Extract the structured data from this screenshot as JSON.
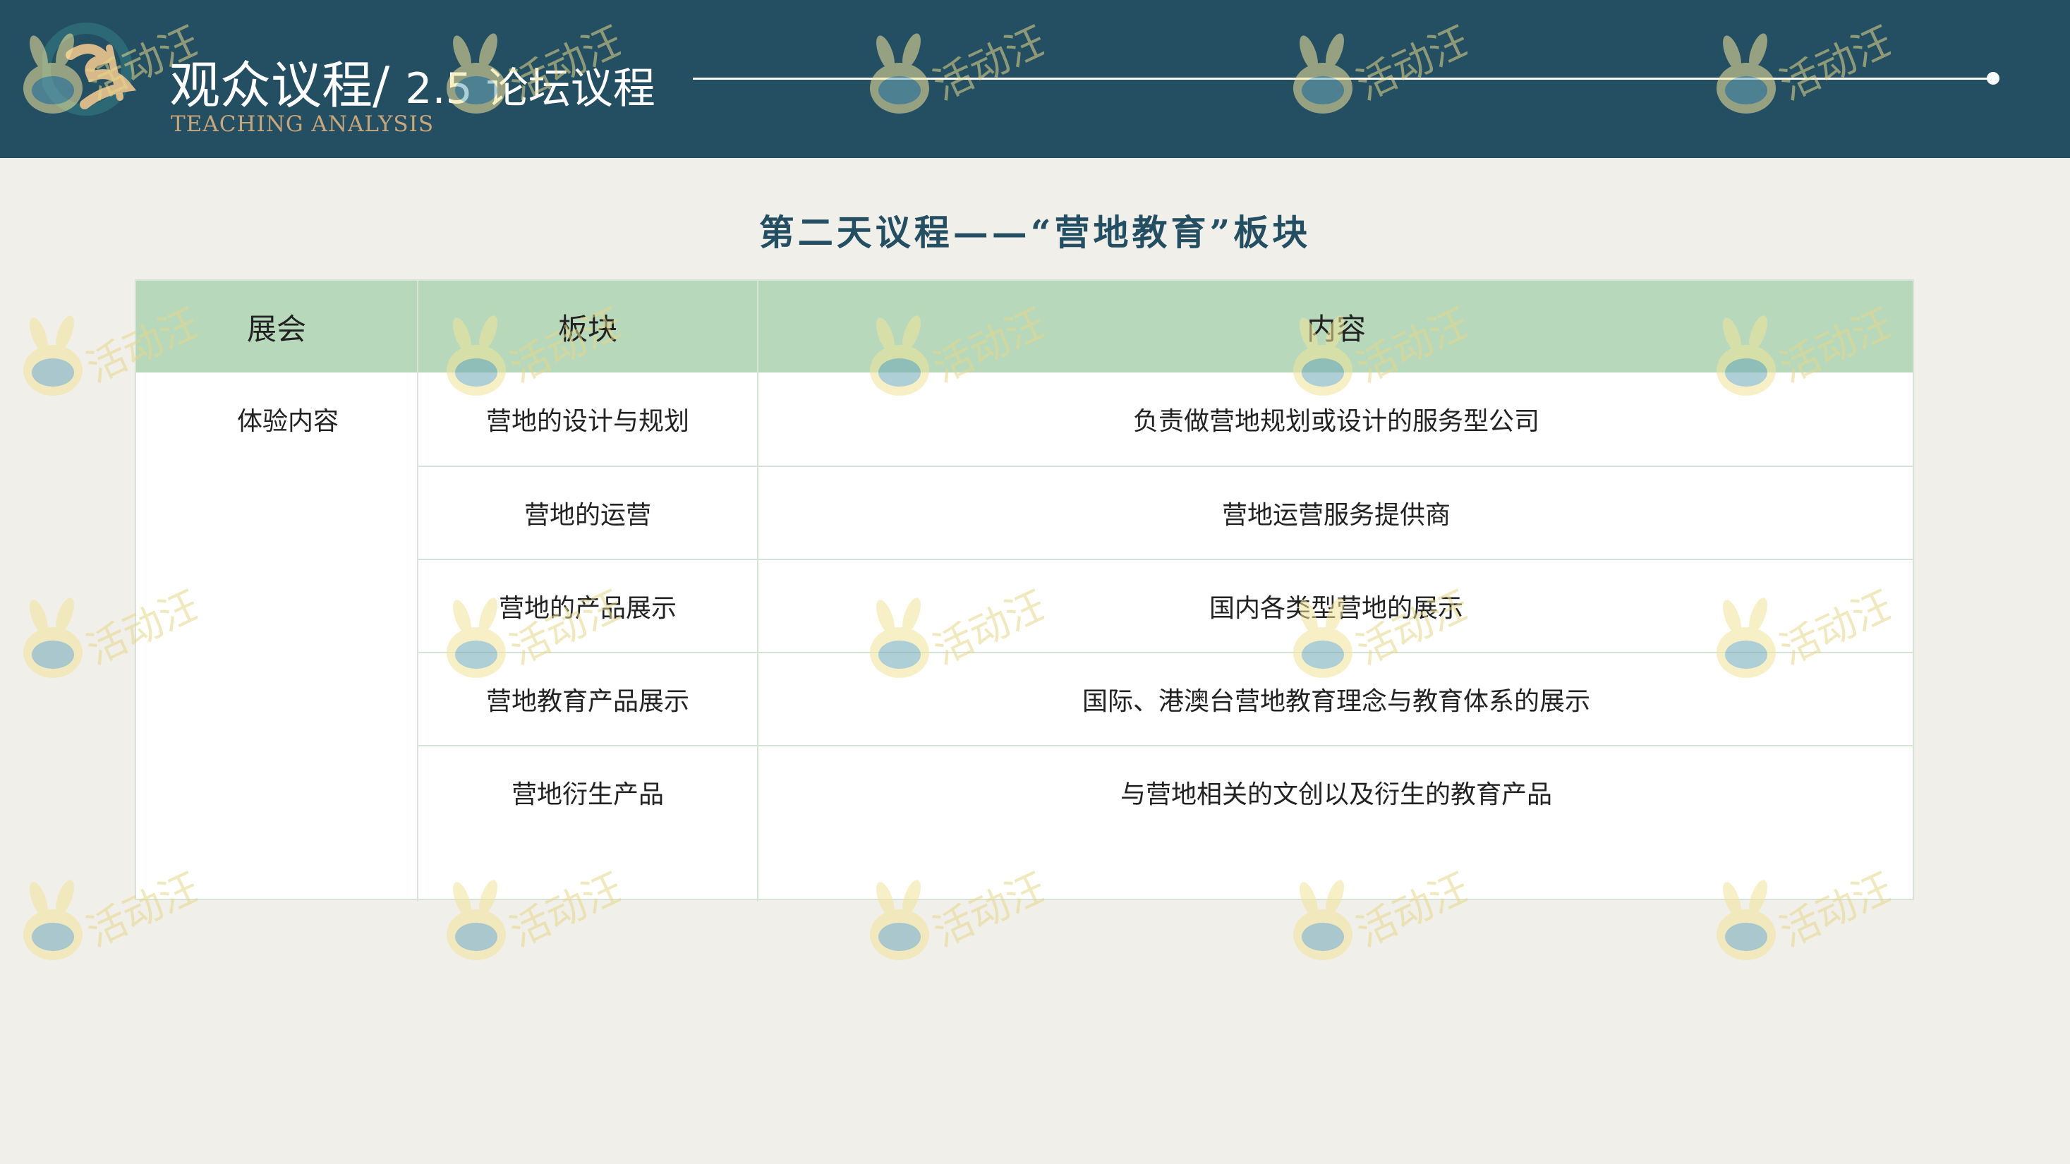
{
  "header": {
    "title": "观众议程/",
    "section": "2.5 论坛议程",
    "subtitle": "TEACHING ANALYSIS",
    "logo_icon": "calligraphy-logo-icon"
  },
  "section_title": "第二天议程——“营地教育”板块",
  "table": {
    "headers": [
      "展会",
      "板块",
      "内容"
    ],
    "group_label": "体验内容",
    "rows": [
      {
        "block": "营地的设计与规划",
        "content": "负责做营地规划或设计的服务型公司"
      },
      {
        "block": "营地的运营",
        "content": "营地运营服务提供商"
      },
      {
        "block": "营地的产品展示",
        "content": "国内各类型营地的展示"
      },
      {
        "block": "营地教育产品展示",
        "content": "国际、港澳台营地教育理念与教育体系的展示"
      },
      {
        "block": "营地衍生产品",
        "content": "与营地相关的文创以及衍生的教育产品"
      }
    ]
  },
  "watermark": {
    "text": "活动汪",
    "icon": "bunny-mascot-icon"
  },
  "colors": {
    "header_bg": "#244f63",
    "table_header_bg": "#b8d8bc",
    "page_bg": "#f1efe9",
    "accent_gold": "#c9a77a"
  }
}
